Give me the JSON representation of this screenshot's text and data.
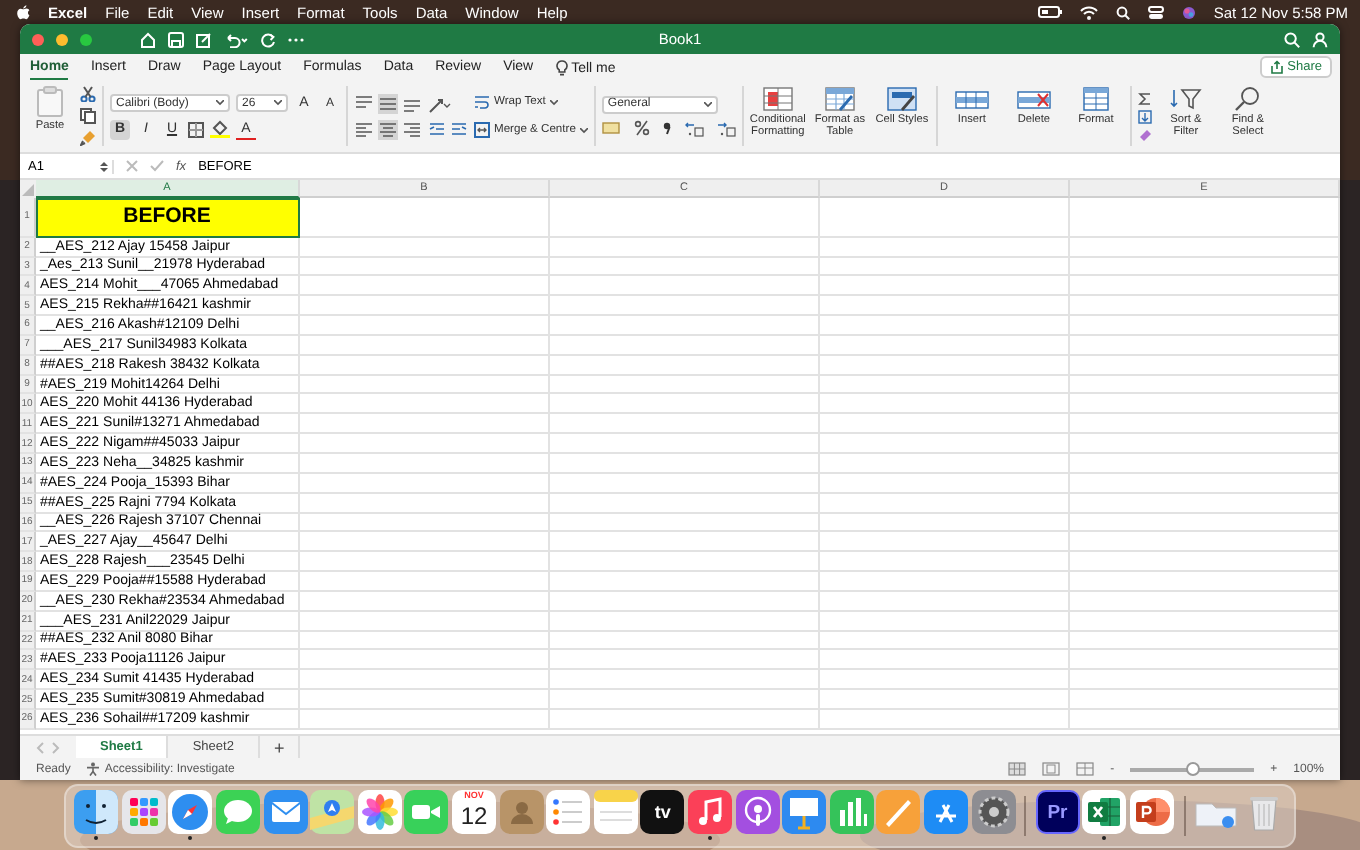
{
  "menu_bar": {
    "app": "Excel",
    "items": [
      "File",
      "Edit",
      "View",
      "Insert",
      "Format",
      "Tools",
      "Data",
      "Window",
      "Help"
    ],
    "clock": "Sat 12 Nov  5:58 PM"
  },
  "window": {
    "title": "Book1"
  },
  "ribbon_tabs": [
    {
      "label": "Home",
      "selected": true
    },
    {
      "label": "Insert",
      "selected": false
    },
    {
      "label": "Draw",
      "selected": false
    },
    {
      "label": "Page Layout",
      "selected": false
    },
    {
      "label": "Formulas",
      "selected": false
    },
    {
      "label": "Data",
      "selected": false
    },
    {
      "label": "Review",
      "selected": false
    },
    {
      "label": "View",
      "selected": false
    }
  ],
  "tell_me": "Tell me",
  "share": "Share",
  "ribbon": {
    "paste": "Paste",
    "font_name": "Calibri (Body)",
    "font_size": "26",
    "grow_font": "A",
    "shrink_font": "A",
    "font_color": "A",
    "format_toggles": [
      {
        "kind": "bold",
        "label": "B",
        "on": true
      },
      {
        "kind": "italic",
        "label": "I",
        "on": false
      },
      {
        "kind": "underline",
        "label": "U",
        "on": false
      }
    ],
    "alignment": [
      {
        "kind": "top",
        "on": false
      },
      {
        "kind": "middle",
        "on": true
      },
      {
        "kind": "bottom",
        "on": false
      },
      {
        "kind": "left",
        "on": false
      },
      {
        "kind": "center",
        "on": true
      },
      {
        "kind": "right",
        "on": false
      }
    ],
    "wrap_text": "Wrap Text",
    "merge": "Merge & Centre",
    "number_format": "General",
    "large_buttons": [
      {
        "kind": "conditional",
        "label": "Conditional Formatting"
      },
      {
        "kind": "table",
        "label": "Format as Table"
      },
      {
        "kind": "styles",
        "label": "Cell Styles"
      },
      {
        "kind": "insert",
        "label": "Insert"
      },
      {
        "kind": "delete",
        "label": "Delete"
      },
      {
        "kind": "format",
        "label": "Format"
      },
      {
        "kind": "sort",
        "label": "Sort & Filter"
      },
      {
        "kind": "find",
        "label": "Find & Select"
      }
    ]
  },
  "formula_bar": {
    "cell_ref": "A1",
    "fx": "fx",
    "content": "BEFORE"
  },
  "sheet": {
    "columns": [
      {
        "label": "A",
        "selected": true
      },
      {
        "label": "B",
        "selected": false
      },
      {
        "label": "C",
        "selected": false
      },
      {
        "label": "D",
        "selected": false
      },
      {
        "label": "E",
        "selected": false
      }
    ],
    "rows": [
      {
        "number": "1",
        "cell": "BEFORE",
        "kind": "heading"
      },
      {
        "number": "2",
        "cell": "__AES_212 Ajay 15458 Jaipur",
        "kind": "data"
      },
      {
        "number": "3",
        "cell": "_Aes_213 Sunil__21978 Hyderabad",
        "kind": "data"
      },
      {
        "number": "4",
        "cell": "AES_214 Mohit___47065 Ahmedabad",
        "kind": "data"
      },
      {
        "number": "5",
        "cell": "AES_215 Rekha##16421 kashmir",
        "kind": "data"
      },
      {
        "number": "6",
        "cell": "__AES_216 Akash#12109 Delhi",
        "kind": "data"
      },
      {
        "number": "7",
        "cell": "___AES_217 Sunil34983 Kolkata",
        "kind": "data"
      },
      {
        "number": "8",
        "cell": "##AES_218 Rakesh 38432 Kolkata",
        "kind": "data"
      },
      {
        "number": "9",
        "cell": "#AES_219 Mohit14264 Delhi",
        "kind": "data"
      },
      {
        "number": "10",
        "cell": "AES_220 Mohit 44136 Hyderabad",
        "kind": "data"
      },
      {
        "number": "11",
        "cell": "AES_221 Sunil#13271 Ahmedabad",
        "kind": "data"
      },
      {
        "number": "12",
        "cell": "AES_222 Nigam##45033 Jaipur",
        "kind": "data"
      },
      {
        "number": "13",
        "cell": "AES_223 Neha__34825 kashmir",
        "kind": "data"
      },
      {
        "number": "14",
        "cell": "#AES_224 Pooja_15393 Bihar",
        "kind": "data"
      },
      {
        "number": "15",
        "cell": "##AES_225 Rajni 7794 Kolkata",
        "kind": "data"
      },
      {
        "number": "16",
        "cell": "__AES_226 Rajesh 37107 Chennai",
        "kind": "data"
      },
      {
        "number": "17",
        "cell": "_AES_227 Ajay__45647 Delhi",
        "kind": "data"
      },
      {
        "number": "18",
        "cell": "AES_228 Rajesh___23545 Delhi",
        "kind": "data"
      },
      {
        "number": "19",
        "cell": "AES_229 Pooja##15588 Hyderabad",
        "kind": "data"
      },
      {
        "number": "20",
        "cell": "__AES_230 Rekha#23534 Ahmedabad",
        "kind": "data"
      },
      {
        "number": "21",
        "cell": "___AES_231 Anil22029 Jaipur",
        "kind": "data"
      },
      {
        "number": "22",
        "cell": "##AES_232 Anil 8080 Bihar",
        "kind": "data"
      },
      {
        "number": "23",
        "cell": "#AES_233 Pooja11126 Jaipur",
        "kind": "data"
      },
      {
        "number": "24",
        "cell": "AES_234 Sumit 41435 Hyderabad",
        "kind": "data"
      },
      {
        "number": "25",
        "cell": "AES_235 Sumit#30819 Ahmedabad",
        "kind": "data"
      },
      {
        "number": "26",
        "cell": "AES_236 Sohail##17209 kashmir",
        "kind": "data"
      }
    ]
  },
  "sheet_tabs": [
    {
      "label": "Sheet1",
      "selected": true
    },
    {
      "label": "Sheet2",
      "selected": false
    }
  ],
  "add_sheet": "+",
  "status_bar": {
    "ready": "Ready",
    "accessibility": "Accessibility: Investigate",
    "zoom_minus": "-",
    "zoom_plus": "+",
    "zoom": {
      "level": 0.5
    },
    "zoom_reading": "100%"
  },
  "dock": [
    {
      "kind": "finder",
      "running": true
    },
    {
      "kind": "launchpad",
      "running": false
    },
    {
      "kind": "safari",
      "running": true
    },
    {
      "kind": "messages",
      "running": false
    },
    {
      "kind": "mail",
      "running": false
    },
    {
      "kind": "maps",
      "running": false
    },
    {
      "kind": "photos",
      "running": false
    },
    {
      "kind": "facetime",
      "running": false
    },
    {
      "kind": "calendar",
      "month": "NOV",
      "day": "12",
      "running": false
    },
    {
      "kind": "contacts",
      "running": false
    },
    {
      "kind": "reminders",
      "running": false
    },
    {
      "kind": "notes",
      "running": false
    },
    {
      "kind": "tv",
      "label": "tv",
      "running": false
    },
    {
      "kind": "music",
      "running": true
    },
    {
      "kind": "podcasts",
      "running": false
    },
    {
      "kind": "keynote",
      "running": false
    },
    {
      "kind": "numbers",
      "running": false
    },
    {
      "kind": "pages",
      "running": false
    },
    {
      "kind": "appstore",
      "running": false
    },
    {
      "kind": "settings",
      "running": false
    },
    {
      "kind": "separator"
    },
    {
      "kind": "premiere",
      "label": "Pr",
      "running": false
    },
    {
      "kind": "excel",
      "running": true
    },
    {
      "kind": "powerpoint",
      "running": false
    },
    {
      "kind": "separator"
    },
    {
      "kind": "downloads",
      "running": false
    },
    {
      "kind": "trash",
      "running": false
    }
  ]
}
